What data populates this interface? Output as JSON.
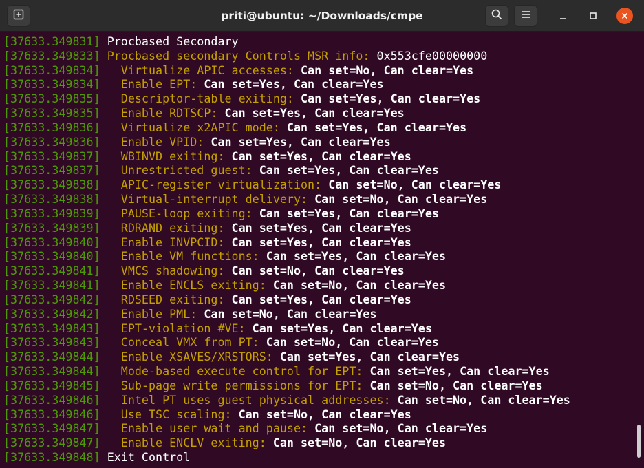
{
  "window": {
    "title": "priti@ubuntu: ~/Downloads/cmpe"
  },
  "colors": {
    "background": "#300a24",
    "timestamp": "#4e9a06",
    "field_name": "#c4a000",
    "value": "#ffffff",
    "close_button": "#e95420"
  },
  "icons": {
    "new_tab": "new-tab-icon",
    "search": "search-icon",
    "menu": "hamburger-menu-icon",
    "minimize": "minimize-icon",
    "maximize": "maximize-icon",
    "close": "close-icon"
  },
  "terminal": {
    "lines": [
      {
        "ts": "[37633.349831]",
        "name": " Procbased Secondary",
        "val": "",
        "plain": true
      },
      {
        "ts": "[37633.349833]",
        "name": " Procbased secondary Controls MSR info: ",
        "val": "0x553cfe00000000",
        "plainval": true
      },
      {
        "ts": "[37633.349834]",
        "name": "   Virtualize APIC accesses:",
        "val": " Can set=No, Can clear=Yes"
      },
      {
        "ts": "[37633.349834]",
        "name": "   Enable EPT:",
        "val": " Can set=Yes, Can clear=Yes"
      },
      {
        "ts": "[37633.349835]",
        "name": "   Descriptor-table exiting:",
        "val": " Can set=Yes, Can clear=Yes"
      },
      {
        "ts": "[37633.349835]",
        "name": "   Enable RDTSCP:",
        "val": " Can set=Yes, Can clear=Yes"
      },
      {
        "ts": "[37633.349836]",
        "name": "   Virtualize x2APIC mode:",
        "val": " Can set=Yes, Can clear=Yes"
      },
      {
        "ts": "[37633.349836]",
        "name": "   Enable VPID:",
        "val": " Can set=Yes, Can clear=Yes"
      },
      {
        "ts": "[37633.349837]",
        "name": "   WBINVD exiting:",
        "val": " Can set=Yes, Can clear=Yes"
      },
      {
        "ts": "[37633.349837]",
        "name": "   Unrestricted guest:",
        "val": " Can set=Yes, Can clear=Yes"
      },
      {
        "ts": "[37633.349838]",
        "name": "   APIC-register virtualization:",
        "val": " Can set=No, Can clear=Yes"
      },
      {
        "ts": "[37633.349838]",
        "name": "   Virtual-interrupt delivery:",
        "val": " Can set=No, Can clear=Yes"
      },
      {
        "ts": "[37633.349839]",
        "name": "   PAUSE-loop exiting:",
        "val": " Can set=Yes, Can clear=Yes"
      },
      {
        "ts": "[37633.349839]",
        "name": "   RDRAND exiting:",
        "val": " Can set=Yes, Can clear=Yes"
      },
      {
        "ts": "[37633.349840]",
        "name": "   Enable INVPCID:",
        "val": " Can set=Yes, Can clear=Yes"
      },
      {
        "ts": "[37633.349840]",
        "name": "   Enable VM functions:",
        "val": " Can set=Yes, Can clear=Yes"
      },
      {
        "ts": "[37633.349841]",
        "name": "   VMCS shadowing:",
        "val": " Can set=No, Can clear=Yes"
      },
      {
        "ts": "[37633.349841]",
        "name": "   Enable ENCLS exiting:",
        "val": " Can set=No, Can clear=Yes"
      },
      {
        "ts": "[37633.349842]",
        "name": "   RDSEED exiting:",
        "val": " Can set=Yes, Can clear=Yes"
      },
      {
        "ts": "[37633.349842]",
        "name": "   Enable PML:",
        "val": " Can set=No, Can clear=Yes"
      },
      {
        "ts": "[37633.349843]",
        "name": "   EPT-violation #VE:",
        "val": " Can set=Yes, Can clear=Yes"
      },
      {
        "ts": "[37633.349843]",
        "name": "   Conceal VMX from PT:",
        "val": " Can set=No, Can clear=Yes"
      },
      {
        "ts": "[37633.349844]",
        "name": "   Enable XSAVES/XRSTORS:",
        "val": " Can set=Yes, Can clear=Yes"
      },
      {
        "ts": "[37633.349844]",
        "name": "   Mode-based execute control for EPT:",
        "val": " Can set=Yes, Can clear=Yes"
      },
      {
        "ts": "[37633.349845]",
        "name": "   Sub-page write permissions for EPT:",
        "val": " Can set=No, Can clear=Yes"
      },
      {
        "ts": "[37633.349846]",
        "name": "   Intel PT uses guest physical addresses:",
        "val": " Can set=No, Can clear=Yes"
      },
      {
        "ts": "[37633.349846]",
        "name": "   Use TSC scaling:",
        "val": " Can set=No, Can clear=Yes"
      },
      {
        "ts": "[37633.349847]",
        "name": "   Enable user wait and pause:",
        "val": " Can set=No, Can clear=Yes"
      },
      {
        "ts": "[37633.349847]",
        "name": "   Enable ENCLV exiting:",
        "val": " Can set=No, Can clear=Yes"
      },
      {
        "ts": "[37633.349848]",
        "name": " Exit Control",
        "val": "",
        "plain": true
      }
    ]
  }
}
